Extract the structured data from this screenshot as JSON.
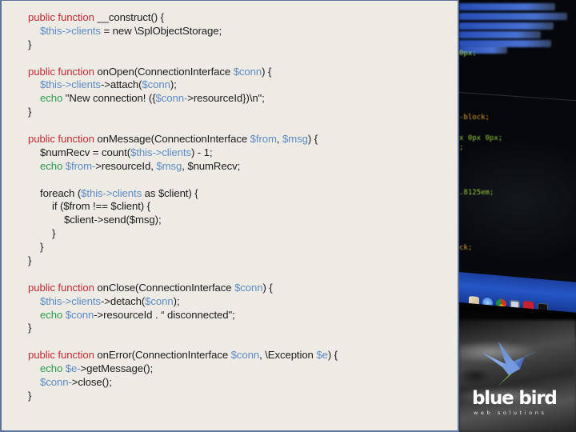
{
  "slide": {
    "code_lines": [
      {
        "indent": 0,
        "tokens": [
          {
            "t": "public function",
            "c": "kw"
          },
          {
            "t": " __construct() {",
            "c": ""
          }
        ]
      },
      {
        "indent": 1,
        "tokens": [
          {
            "t": "$this->clients",
            "c": "var"
          },
          {
            "t": " = new \\SplObjectStorage;",
            "c": ""
          }
        ]
      },
      {
        "indent": 0,
        "tokens": [
          {
            "t": "}",
            "c": ""
          }
        ]
      },
      {
        "indent": 0,
        "tokens": []
      },
      {
        "indent": 0,
        "tokens": [
          {
            "t": "public function",
            "c": "kw"
          },
          {
            "t": " onOpen(ConnectionInterface ",
            "c": ""
          },
          {
            "t": "$conn",
            "c": "var"
          },
          {
            "t": ") {",
            "c": ""
          }
        ]
      },
      {
        "indent": 1,
        "tokens": [
          {
            "t": "$this->clients",
            "c": "var"
          },
          {
            "t": "->attach(",
            "c": ""
          },
          {
            "t": "$conn",
            "c": "var"
          },
          {
            "t": ");",
            "c": ""
          }
        ]
      },
      {
        "indent": 1,
        "tokens": [
          {
            "t": "echo",
            "c": "ech"
          },
          {
            "t": " \"New connection! ({",
            "c": ""
          },
          {
            "t": "$conn-",
            "c": "var"
          },
          {
            "t": ">resourceId})\\n\";",
            "c": ""
          }
        ]
      },
      {
        "indent": 0,
        "tokens": [
          {
            "t": "}",
            "c": ""
          }
        ]
      },
      {
        "indent": 0,
        "tokens": []
      },
      {
        "indent": 0,
        "tokens": [
          {
            "t": "public function",
            "c": "kw"
          },
          {
            "t": " onMessage(ConnectionInterface ",
            "c": ""
          },
          {
            "t": "$from",
            "c": "var"
          },
          {
            "t": ", ",
            "c": ""
          },
          {
            "t": "$msg",
            "c": "var"
          },
          {
            "t": ") {",
            "c": ""
          }
        ]
      },
      {
        "indent": 1,
        "tokens": [
          {
            "t": "$numRecv = count(",
            "c": ""
          },
          {
            "t": "$this->clients",
            "c": "var"
          },
          {
            "t": ") - 1;",
            "c": ""
          }
        ]
      },
      {
        "indent": 1,
        "tokens": [
          {
            "t": "echo",
            "c": "ech"
          },
          {
            "t": " ",
            "c": ""
          },
          {
            "t": "$from-",
            "c": "var"
          },
          {
            "t": ">resourceId, ",
            "c": ""
          },
          {
            "t": "$msg",
            "c": "var"
          },
          {
            "t": ", $numRecv;",
            "c": ""
          }
        ]
      },
      {
        "indent": 0,
        "tokens": []
      },
      {
        "indent": 1,
        "tokens": [
          {
            "t": "foreach (",
            "c": ""
          },
          {
            "t": "$this->clients",
            "c": "var"
          },
          {
            "t": " as $client) {",
            "c": ""
          }
        ]
      },
      {
        "indent": 2,
        "tokens": [
          {
            "t": "if ($from !== $client) {",
            "c": ""
          }
        ]
      },
      {
        "indent": 3,
        "tokens": [
          {
            "t": "$client->send($msg);",
            "c": ""
          }
        ]
      },
      {
        "indent": 2,
        "tokens": [
          {
            "t": "}",
            "c": ""
          }
        ]
      },
      {
        "indent": 1,
        "tokens": [
          {
            "t": "}",
            "c": ""
          }
        ]
      },
      {
        "indent": 0,
        "tokens": [
          {
            "t": "}",
            "c": ""
          }
        ]
      },
      {
        "indent": 0,
        "tokens": []
      },
      {
        "indent": 0,
        "tokens": [
          {
            "t": "public function",
            "c": "kw"
          },
          {
            "t": " onClose(ConnectionInterface ",
            "c": ""
          },
          {
            "t": "$conn",
            "c": "var"
          },
          {
            "t": ") {",
            "c": ""
          }
        ]
      },
      {
        "indent": 1,
        "tokens": [
          {
            "t": "$this->clients",
            "c": "var"
          },
          {
            "t": "->detach(",
            "c": ""
          },
          {
            "t": "$conn",
            "c": "var"
          },
          {
            "t": ");",
            "c": ""
          }
        ]
      },
      {
        "indent": 1,
        "tokens": [
          {
            "t": "echo",
            "c": "ech"
          },
          {
            "t": " ",
            "c": ""
          },
          {
            "t": "$conn",
            "c": "var"
          },
          {
            "t": "->resourceId . “ disconnected\";",
            "c": ""
          }
        ]
      },
      {
        "indent": 0,
        "tokens": [
          {
            "t": "}",
            "c": ""
          }
        ]
      },
      {
        "indent": 0,
        "tokens": []
      },
      {
        "indent": 0,
        "tokens": [
          {
            "t": "public function",
            "c": "kw"
          },
          {
            "t": " onError(ConnectionInterface ",
            "c": ""
          },
          {
            "t": "$conn",
            "c": "var"
          },
          {
            "t": ", \\Exception ",
            "c": ""
          },
          {
            "t": "$e",
            "c": "var"
          },
          {
            "t": ") {",
            "c": ""
          }
        ]
      },
      {
        "indent": 1,
        "tokens": [
          {
            "t": "echo",
            "c": "ech"
          },
          {
            "t": " ",
            "c": ""
          },
          {
            "t": "$e-",
            "c": "var"
          },
          {
            "t": ">getMessage();",
            "c": ""
          }
        ]
      },
      {
        "indent": 1,
        "tokens": [
          {
            "t": "$conn-",
            "c": "var"
          },
          {
            "t": ">close();",
            "c": ""
          }
        ]
      },
      {
        "indent": 0,
        "tokens": [
          {
            "t": "}",
            "c": ""
          }
        ]
      }
    ]
  },
  "colors": {
    "keyword": "#c22a35",
    "variable": "#5f8ac6",
    "echo": "#2d9a4e",
    "panel_background": "#edebe4",
    "panel_border": "#5d7199"
  },
  "background_photo": {
    "screen_snippets": [
      "0px;",
      "-block;",
      "x 0px 0px;",
      ";",
      ".8125em;",
      "ck;"
    ],
    "dock_icons": [
      "contacts-icon",
      "safari-icon",
      "chrome-icon",
      "finder-icon",
      "filezilla-icon",
      "terminal-icon"
    ]
  },
  "logo": {
    "name": "blue bird",
    "tagline": "web solutions",
    "icon": "hummingbird-icon"
  }
}
